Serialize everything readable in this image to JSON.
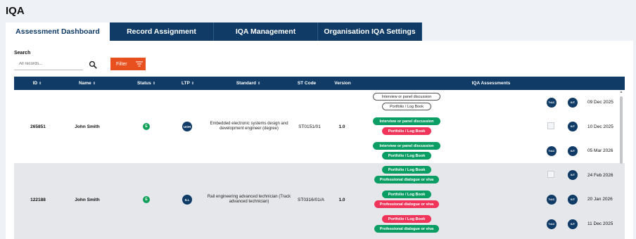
{
  "page": {
    "title": "IQA"
  },
  "tabs": [
    {
      "label": "Assessment Dashboard",
      "active": true
    },
    {
      "label": "Record Assignment",
      "active": false
    },
    {
      "label": "IQA Management",
      "active": false
    },
    {
      "label": "Organisation IQA Settings",
      "active": false
    }
  ],
  "search": {
    "label": "Search",
    "placeholder": "All records..."
  },
  "filter": {
    "label": "Filter"
  },
  "table": {
    "headers": {
      "id": "ID",
      "name": "Name",
      "status": "Status",
      "ltp": "LTP",
      "standard": "Standard",
      "st_code": "ST Code",
      "version": "Version",
      "iqa_assessments": "IQA Assessments"
    },
    "rows": [
      {
        "id": "265851",
        "name": "John Smith",
        "status": "E",
        "ltp": "UOH",
        "standard": "Embedded electronic systems design and development engineer (degree)",
        "st_code": "ST0151/01",
        "version": "1.0",
        "assessments": [
          {
            "methods": [
              {
                "label": "Interview or panel discussion",
                "style": "outline"
              },
              {
                "label": "Portfolio / Log Book",
                "style": "outline"
              }
            ],
            "assessor": "TrAC",
            "iqa": "IUT",
            "date": "09 Dec 2025"
          },
          {
            "methods": [
              {
                "label": "Interview or panel discussion",
                "style": "green"
              },
              {
                "label": "Portfolio / Log Book",
                "style": "red"
              }
            ],
            "assessor": "",
            "iqa": "IUT",
            "date": "10 Dec 2025"
          },
          {
            "methods": [
              {
                "label": "Interview or panel discussion",
                "style": "green"
              },
              {
                "label": "Portfolio / Log Book",
                "style": "green"
              }
            ],
            "assessor": "TrAC",
            "iqa": "IUT",
            "date": "05 Mar 2026"
          }
        ]
      },
      {
        "id": "122188",
        "name": "John Smith",
        "status": "E",
        "ltp": "ILL",
        "standard": "Rail engineering advanced technician (Track advanced technician)",
        "st_code": "ST0316/01/A",
        "version": "1.0",
        "assessments": [
          {
            "methods": [
              {
                "label": "Portfolio / Log Book",
                "style": "green"
              },
              {
                "label": "Professional dialogue or viva",
                "style": "green"
              }
            ],
            "assessor": "",
            "iqa": "IUT",
            "date": "24 Feb 2026"
          },
          {
            "methods": [
              {
                "label": "Portfolio / Log Book",
                "style": "green"
              },
              {
                "label": "Professional dialogue or viva",
                "style": "red"
              }
            ],
            "assessor": "TrAC",
            "iqa": "IUT",
            "date": "20 Jan 2026"
          },
          {
            "methods": [
              {
                "label": "Portfolio / Log Book",
                "style": "red"
              },
              {
                "label": "Professional dialogue or viva",
                "style": "green"
              }
            ],
            "assessor": "TrAC",
            "iqa": "IUT",
            "date": "11 Dec 2025"
          }
        ]
      }
    ]
  },
  "colors": {
    "primary": "#0f3b66",
    "accent": "#e8511f",
    "success": "#0b9e64",
    "danger": "#f0345a"
  }
}
